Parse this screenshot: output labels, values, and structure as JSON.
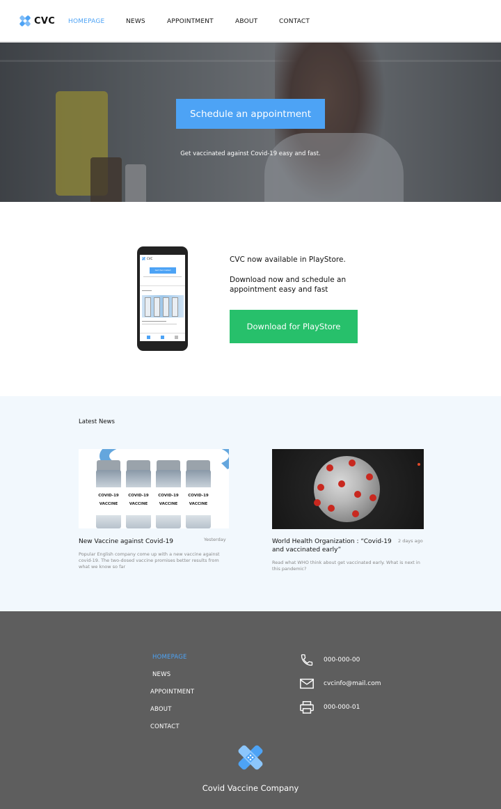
{
  "colors": {
    "accent": "#4da3f5",
    "play_green": "#27c06b",
    "footer_bg": "#5e5e5e",
    "news_bg": "#f2f8fd"
  },
  "header": {
    "logo_text": "CVC",
    "nav": [
      {
        "label": "HOMEPAGE",
        "active": true
      },
      {
        "label": "NEWS",
        "active": false
      },
      {
        "label": "APPOINTMENT",
        "active": false
      },
      {
        "label": "ABOUT",
        "active": false
      },
      {
        "label": "CONTACT",
        "active": false
      }
    ]
  },
  "hero": {
    "button_label": "Schedule an appointment",
    "subtitle": "Get vaccinated against Covid-19 easy and fast."
  },
  "promo": {
    "title": "CVC now available in PlayStore.",
    "description": "Download now and schedule an appointment easy and fast",
    "button_label": "Download for PlayStore",
    "phone_screen": {
      "logo_text": "CVC",
      "button_label": "Get Vaccinated"
    }
  },
  "news": {
    "section_title": "Latest News",
    "items": [
      {
        "title": "New Vaccine against Covid-19",
        "date": "Yesterday",
        "excerpt": "Popular English company come up with a new vaccine against covid-19. The two-dosed vaccine promises better results from what we know so far",
        "vial_label": "COVID-19 VACCINE"
      },
      {
        "title": "World Health Organization : “Covid-19 and vaccinated early”",
        "date": "2 days ago",
        "excerpt": "Read what WHO think about get vaccinated early. What is next in this pandemic?"
      }
    ]
  },
  "footer": {
    "nav": [
      {
        "label": "HOMEPAGE",
        "active": true
      },
      {
        "label": "NEWS",
        "active": false
      },
      {
        "label": "APPOINTMENT",
        "active": false
      },
      {
        "label": "ABOUT",
        "active": false
      },
      {
        "label": "CONTACT",
        "active": false
      }
    ],
    "contacts": [
      {
        "icon": "phone-icon",
        "value": "000-000-00"
      },
      {
        "icon": "mail-icon",
        "value": "cvcinfo@mail.com"
      },
      {
        "icon": "printer-icon",
        "value": "000-000-01"
      }
    ],
    "company_name": "Covid Vaccine Company"
  }
}
